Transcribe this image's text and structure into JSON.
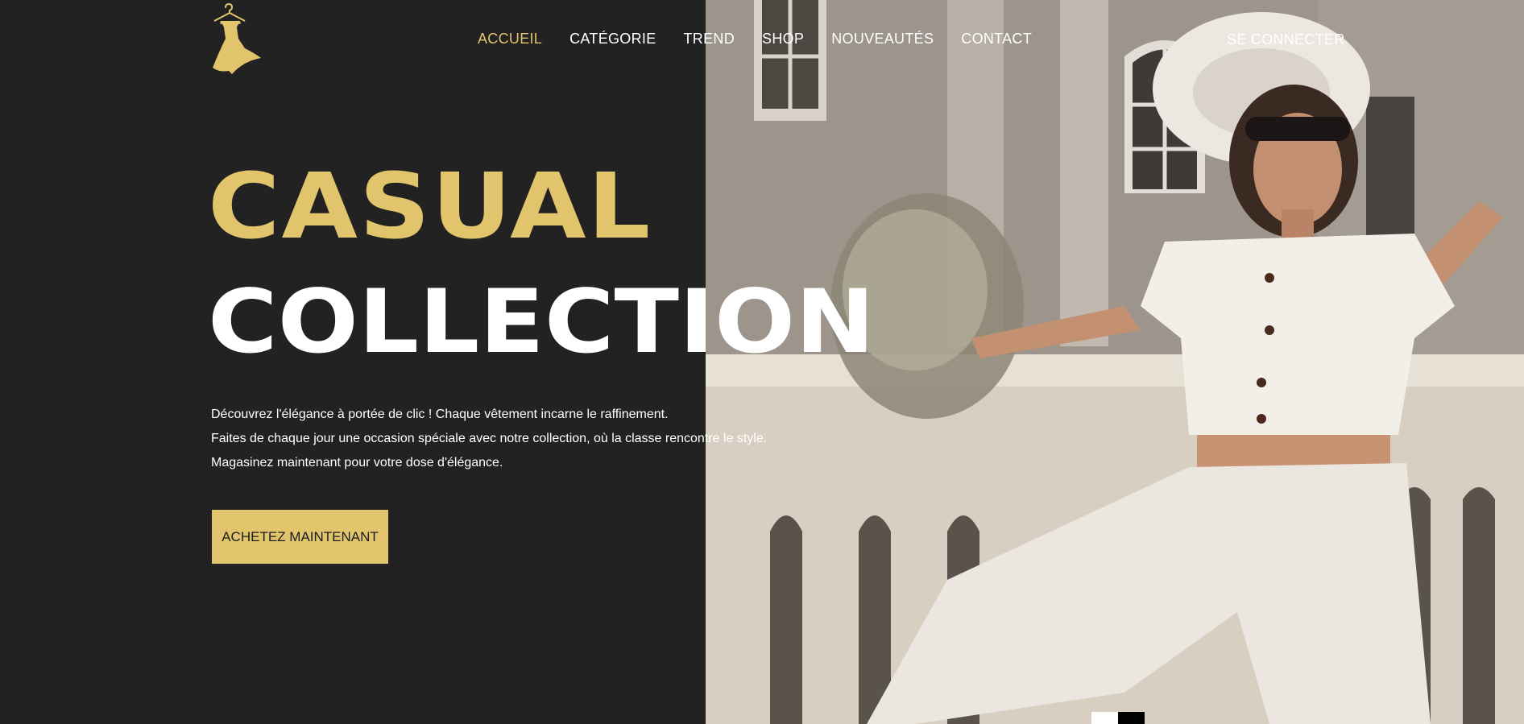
{
  "brand": {
    "logo_icon": "dress-hanger-icon",
    "accent_color": "#e1c46c",
    "background_color": "#222222"
  },
  "nav": {
    "items": [
      {
        "label": "ACCUEIL",
        "active": true
      },
      {
        "label": "CATÉGORIE",
        "active": false
      },
      {
        "label": "TREND",
        "active": false
      },
      {
        "label": "SHOP",
        "active": false
      },
      {
        "label": "NOUVEAUTÉS",
        "active": false
      },
      {
        "label": "CONTACT",
        "active": false
      }
    ],
    "login_label": "SE CONNECTER"
  },
  "hero": {
    "title_line_1": "CASUAL",
    "title_line_2": "COLLECTION",
    "description": [
      "Découvrez l'élégance à portée de clic ! Chaque vêtement incarne le raffinement.",
      "Faites de chaque jour une occasion spéciale avec notre collection, où la classe rencontre le style.",
      "Magasinez maintenant pour votre dose d'élégance."
    ],
    "cta_label": "ACHETEZ MAINTENANT"
  },
  "slider": {
    "slide_count": 2,
    "active_index": 0
  }
}
